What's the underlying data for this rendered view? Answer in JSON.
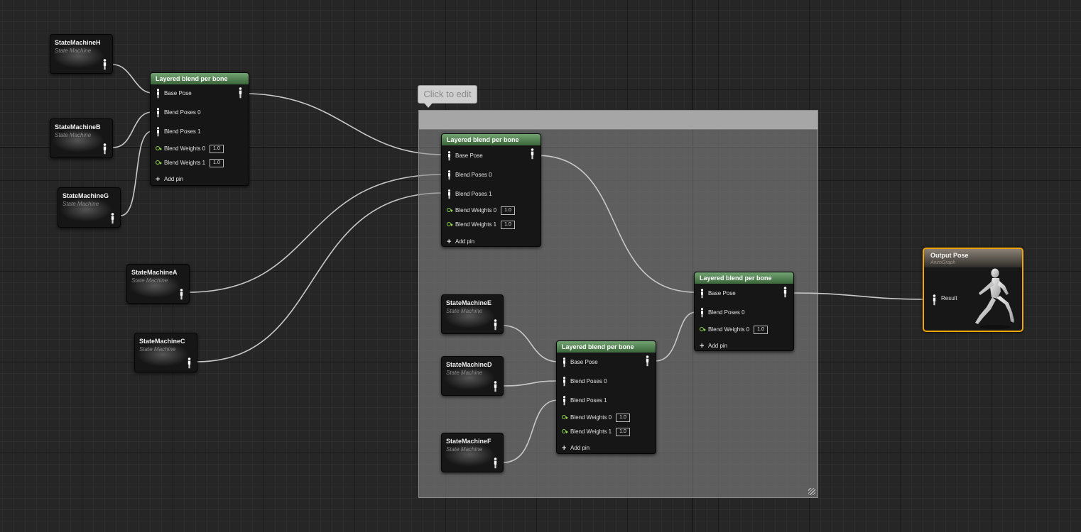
{
  "state_machine_subtitle": "State Machine",
  "state_machines": {
    "H": "StateMachineH",
    "B": "StateMachineB",
    "G": "StateMachineG",
    "A": "StateMachineA",
    "C": "StateMachineC",
    "E": "StateMachineE",
    "D": "StateMachineD",
    "F": "StateMachineF"
  },
  "blend_node": {
    "title": "Layered blend per bone",
    "base_pose": "Base Pose",
    "blend_poses_0": "Blend Poses 0",
    "blend_poses_1": "Blend Poses 1",
    "blend_weights_0": "Blend Weights 0",
    "blend_weights_1": "Blend Weights 1",
    "weight_value": "1.0",
    "add_pin": "Add pin",
    "add_icon": "+"
  },
  "comment": {
    "bubble_text": "Click to edit"
  },
  "output_node": {
    "title": "Output Pose",
    "subtitle": "AnimGraph",
    "result_label": "Result"
  },
  "colors": {
    "blend_header": "#5b8a5b",
    "output_border": "#f2a60a",
    "weight_pin": "#8fd44a",
    "wire": "#c8c8c8"
  }
}
